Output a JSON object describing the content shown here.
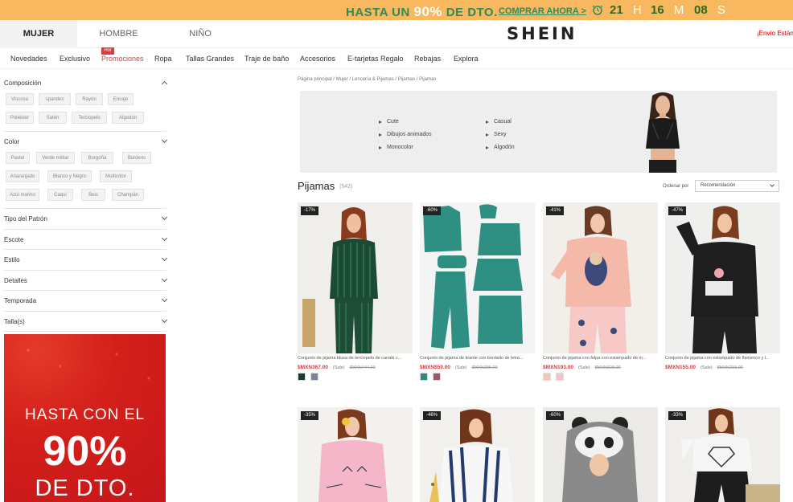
{
  "promo": {
    "text_before": "HASTA UN ",
    "percent": "90%",
    "text_after": " DE DTO.",
    "link": "COMPRAR AHORA >",
    "countdown": [
      {
        "value": "21",
        "unit": "H"
      },
      {
        "value": "16",
        "unit": "M"
      },
      {
        "value": "08",
        "unit": "S"
      }
    ]
  },
  "header": {
    "tabs": [
      "MUJER",
      "HOMBRE",
      "NIÑO"
    ],
    "logo": "SHEIN",
    "shipping": "¡Envío Estánd"
  },
  "nav": {
    "items": [
      "Novedades",
      "Exclusivo",
      "Promociones",
      "Ropa",
      "Tallas Grandes",
      "Traje de baño",
      "Accesorios",
      "E-tarjetas Regalo",
      "Rebajas",
      "Explora"
    ],
    "hot_badge": "Hot"
  },
  "filters": {
    "composicion": {
      "title": "Composición",
      "chips": [
        "Viscosa",
        "spandex",
        "Rayón",
        "Encaje",
        "Poliéster",
        "Satén",
        "Terciopelo",
        "Algodón"
      ]
    },
    "color": {
      "title": "Color",
      "chips": [
        "Pastel",
        "Verde militar",
        "Borgoña",
        "Burdeos",
        "Anaranjado",
        "Blanco y Negro",
        "Multicolor",
        "Azul marino",
        "Caqui",
        "Beis",
        "Champán"
      ]
    },
    "collapsed": [
      "Tipo del Patrón",
      "Escote",
      "Estilo",
      "Detalles",
      "Temporada",
      "Talla(s)"
    ]
  },
  "side_banner": {
    "line1": "HASTA CON EL",
    "line2": "90%",
    "line3": "DE DTO."
  },
  "breadcrumb": "Página principal  /  Mujer  /  Lencería & Pijamas  /  Pijamas  /  Pijamas",
  "hero": {
    "categories": [
      "Cute",
      "Dibujos animados",
      "Monocolor",
      "Casual",
      "Sexy",
      "Algodón"
    ]
  },
  "listing": {
    "title": "Pijamas",
    "count": "(542)",
    "sort_label": "Ordenar por",
    "sort_value": "Recomendación"
  },
  "products": [
    {
      "discount": "-17%",
      "name": "Conjunto de pijama blusa de terciopelo de canalé c...",
      "price": "$MXN367.00",
      "sale": "(Sale)",
      "old_price": "$MXN444.00",
      "swatches": [
        "#1d3a2c",
        "#7a8293"
      ]
    },
    {
      "discount": "-60%",
      "name": "Conjunto de pijama de tirante con bordado de letra...",
      "price": "$MXN$59.00",
      "sale": "(Sale)",
      "old_price": "$MXN395.00",
      "swatches": [
        "#2e8a7e",
        "#9c5866"
      ]
    },
    {
      "discount": "-41%",
      "name": "Conjunto de pijama con felpa con estampado de m...",
      "price": "$MXN193.00",
      "sale": "(Sale)",
      "old_price": "$MXN328.00",
      "swatches": [
        "#f5c5b8",
        "#f4c4cc"
      ]
    },
    {
      "discount": "-47%",
      "name": "Conjunto de pijama con estampado de flamenco y l...",
      "price": "$MXN155.00",
      "sale": "(Sale)",
      "old_price": "$MXN293.00",
      "swatches": []
    },
    {
      "discount": "-35%",
      "name": "",
      "price": "",
      "sale": "",
      "old_price": "",
      "swatches": []
    },
    {
      "discount": "-46%",
      "name": "",
      "price": "",
      "sale": "",
      "old_price": "",
      "swatches": []
    },
    {
      "discount": "-60%",
      "name": "",
      "price": "",
      "sale": "",
      "old_price": "",
      "swatches": []
    },
    {
      "discount": "-33%",
      "name": "",
      "price": "",
      "sale": "",
      "old_price": "",
      "swatches": []
    }
  ]
}
